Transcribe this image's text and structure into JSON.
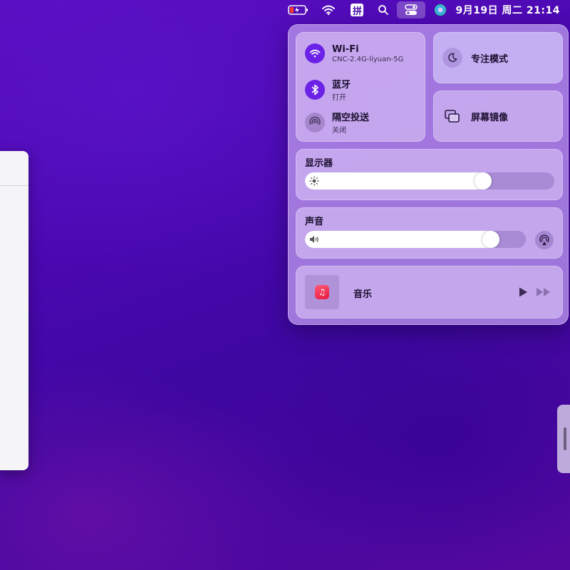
{
  "menubar": {
    "input_method": "拼",
    "clock": "9月19日 周二  21:14"
  },
  "network": {
    "wifi": {
      "title": "Wi-Fi",
      "subtitle": "CNC-2.4G-liyuan-5G",
      "on": true
    },
    "bluetooth": {
      "title": "蓝牙",
      "subtitle": "打开",
      "on": true
    },
    "airdrop": {
      "title": "隔空投送",
      "subtitle": "关闭",
      "on": false
    }
  },
  "focus": {
    "label": "专注模式"
  },
  "mirror": {
    "label": "屏幕镜像"
  },
  "display": {
    "title": "显示器",
    "brightness": 0.73
  },
  "sound": {
    "title": "声音",
    "volume": 0.87
  },
  "music": {
    "title": "音乐"
  },
  "colors": {
    "accent": "#6b22e6",
    "panel": "#ba96ec"
  },
  "icons": [
    "battery-icon",
    "wifi-icon",
    "input-method-icon",
    "search-icon",
    "control-center-icon",
    "siri-icon",
    "bluetooth-icon",
    "airdrop-icon",
    "moon-icon",
    "screen-mirror-icon",
    "sun-icon",
    "speaker-icon",
    "airplay-icon",
    "music-app-icon",
    "play-icon",
    "fast-forward-icon"
  ]
}
